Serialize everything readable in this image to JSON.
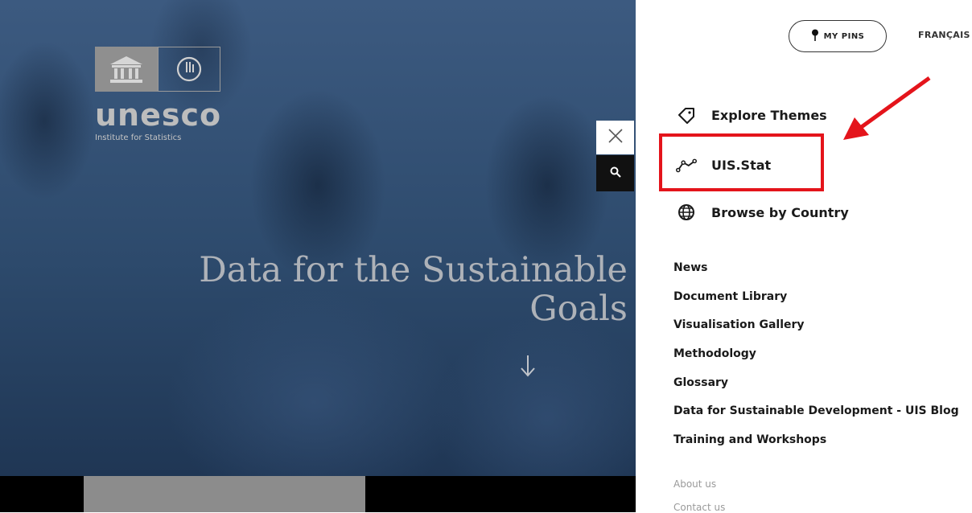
{
  "logo": {
    "wordmark": "unesco",
    "subtitle": "Institute for Statistics"
  },
  "hero": {
    "title_line1": "Data for the Sustainable",
    "title_line2": "Goals"
  },
  "header": {
    "pins_label": "MY PINS",
    "language_label": "FRANÇAIS"
  },
  "menu": {
    "main": [
      {
        "label": "Explore Themes",
        "icon": "tag-icon"
      },
      {
        "label": "UIS.Stat",
        "icon": "line-graph-icon"
      },
      {
        "label": "Browse by Country",
        "icon": "globe-icon"
      }
    ],
    "secondary": [
      "News",
      "Document Library",
      "Visualisation Gallery",
      "Methodology",
      "Glossary",
      "Data for Sustainable Development - UIS Blog",
      "Training and Workshops"
    ],
    "tertiary": [
      "About us",
      "Contact us"
    ]
  },
  "annotation": {
    "highlight_color": "#e4141b"
  }
}
